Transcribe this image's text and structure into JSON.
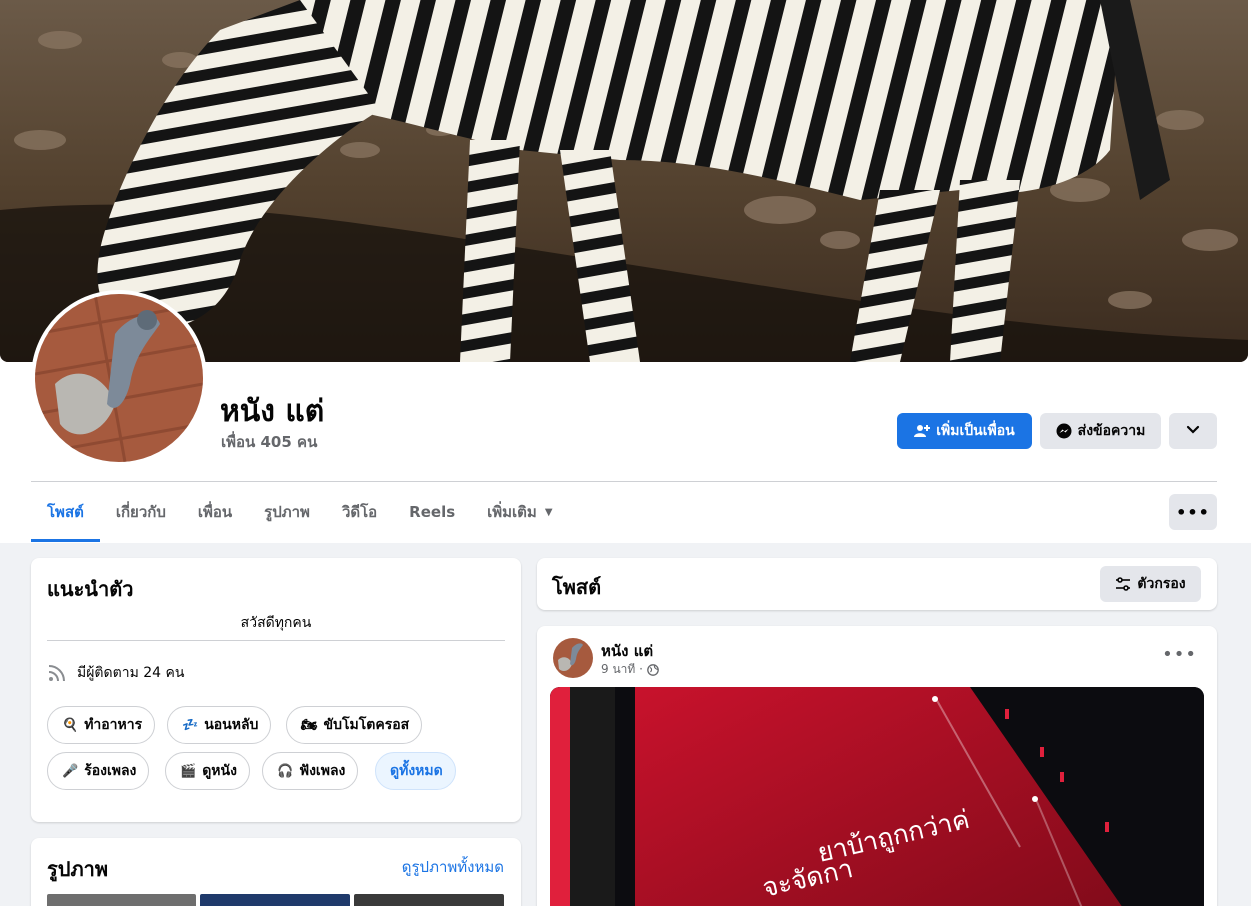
{
  "profile": {
    "name": "หนัง แต่",
    "friends": "เพื่อน 405 คน"
  },
  "actions": {
    "add_friend": "เพิ่มเป็นเพื่อน",
    "message": "ส่งข้อความ"
  },
  "tabs": [
    {
      "label": "โพสต์",
      "active": true
    },
    {
      "label": "เกี่ยวกับ"
    },
    {
      "label": "เพื่อน"
    },
    {
      "label": "รูปภาพ"
    },
    {
      "label": "วิดีโอ"
    },
    {
      "label": "Reels"
    },
    {
      "label": "เพิ่มเติม"
    }
  ],
  "intro": {
    "title": "แนะนำตัว",
    "bio": "สวัสดีทุกคน",
    "followers": "มีผู้ติดตาม 24 คน",
    "hobbies": [
      {
        "emoji": "🍳",
        "label": "ทำอาหาร"
      },
      {
        "emoji": "💤",
        "label": "นอนหลับ"
      },
      {
        "emoji": "🏍",
        "label": "ขับโมโตครอส"
      },
      {
        "emoji": "🎤",
        "label": "ร้องเพลง"
      },
      {
        "emoji": "🎬",
        "label": "ดูหนัง"
      },
      {
        "emoji": "🎧",
        "label": "ฟังเพลง"
      }
    ],
    "see_all": "ดูทั้งหมด"
  },
  "photos": {
    "title": "รูปภาพ",
    "see_all": "ดูรูปภาพทั้งหมด"
  },
  "posts": {
    "title": "โพสต์",
    "filter": "ตัวกรอง"
  },
  "post": {
    "author": "หนัง แต่",
    "time": "9 นาที ·",
    "image_caption_line1": "ยาบ้าถูกกว่าค่",
    "image_caption_line2": "จะจัดกา"
  },
  "colors": {
    "accent": "#1b74e4",
    "secondary_button": "#e4e6eb",
    "background": "#f0f2f5"
  }
}
